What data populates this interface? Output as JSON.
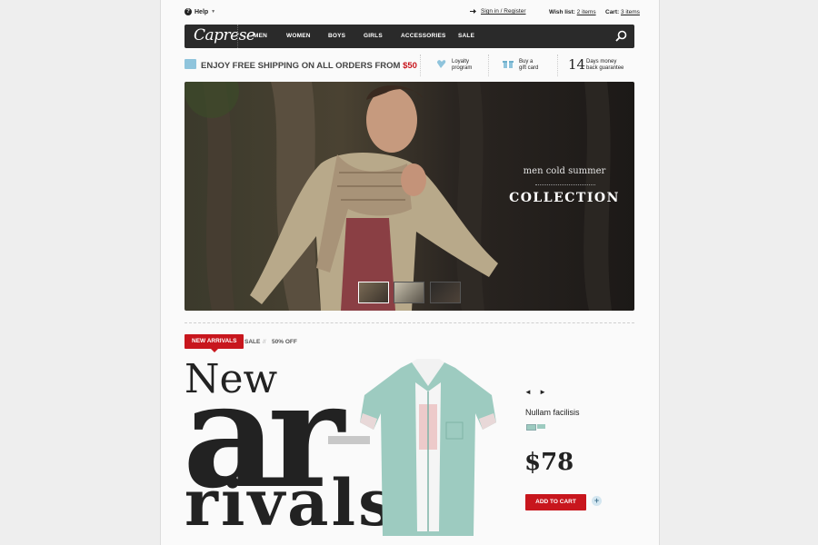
{
  "topbar": {
    "help_label": "Help",
    "signin_label": "Sign in / Register",
    "wishlist_label": "Wish list:",
    "wishlist_count": "2 items",
    "cart_label": "Cart:",
    "cart_count": "3 items"
  },
  "nav": {
    "logo": "Caprese",
    "items": [
      "MEN",
      "WOMEN",
      "BOYS",
      "GIRLS",
      "ACCESSORIES",
      "SALE"
    ]
  },
  "features": {
    "shipping_text": "ENJOY FREE SHIPPING ON ALL ORDERS FROM",
    "shipping_amount": "$50",
    "loyalty_line1": "Loyalty",
    "loyalty_line2": "program",
    "gift_line1": "Buy a",
    "gift_line2": "gift card",
    "days_number": "14",
    "days_line1": "Days money",
    "days_line2": "back guarantee"
  },
  "hero": {
    "subtitle": "men cold summer",
    "title": "COLLECTION"
  },
  "tabs": {
    "active": "NEW ARRIVALS",
    "sale": "SALE",
    "divider": "//",
    "off": "50% OFF"
  },
  "arrivals": {
    "word_new": "New",
    "word_ar": "ar",
    "word_rivals": "rivals"
  },
  "product": {
    "arrows": "◄ ►",
    "name": "Nullam facilisis",
    "price": "$78",
    "add_to_cart": "ADD TO CART",
    "plus": "+"
  },
  "colors": {
    "accent_red": "#c8161d",
    "nav_bg": "#2a2a2a",
    "shirt_green": "#9dcbc0"
  },
  "icons": [
    "help-icon",
    "signin-icon",
    "search-icon",
    "truck-icon",
    "loyalty-icon",
    "gift-icon"
  ]
}
